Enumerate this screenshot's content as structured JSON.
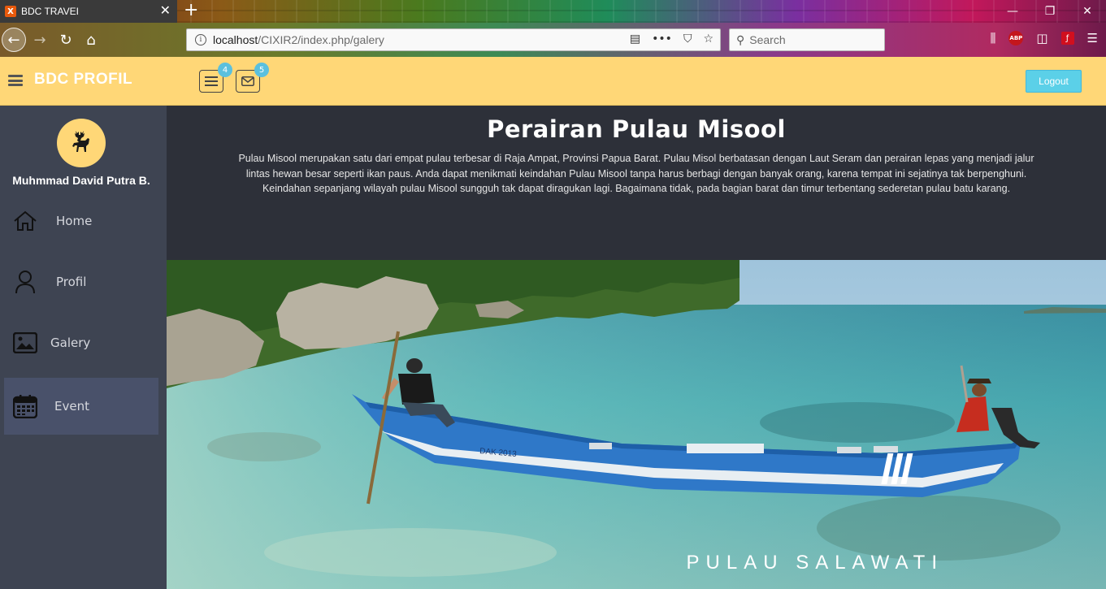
{
  "browser": {
    "tab_title": "BDC TRAVEI",
    "favicon_letter": "X",
    "url_host": "localhost",
    "url_path": "/CIXIR2/index.php/galery",
    "search_placeholder": "Search",
    "abp_label": "ABP"
  },
  "header": {
    "brand": "BDC PROFIL",
    "notifications_count": "4",
    "messages_count": "5",
    "logout_label": "Logout"
  },
  "sidebar": {
    "username": "Muhmmad David Putra B.",
    "items": [
      {
        "label": "Home",
        "icon": "home-icon"
      },
      {
        "label": "Profil",
        "icon": "user-icon"
      },
      {
        "label": "Galery",
        "icon": "image-icon"
      },
      {
        "label": "Event",
        "icon": "calendar-icon"
      }
    ],
    "active_item": "Event"
  },
  "main": {
    "title": "Perairan Pulau Misool",
    "description": "Pulau Misool merupakan satu dari empat pulau terbesar di Raja Ampat, Provinsi Papua Barat. Pulau Misol berbatasan dengan Laut Seram dan perairan lepas yang menjadi jalur lintas hewan besar seperti ikan paus. Anda dapat menikmati keindahan Pulau Misool tanpa harus berbagi dengan banyak orang, karena tempat ini sejatinya tak berpenghuni. Keindahan sepanjang wilayah pulau Misool sungguh tak dapat diragukan lagi. Bagaimana tidak, pada bagian barat dan timur terbentang sederetan pulau batu karang.",
    "photo_caption": "PULAU SALAWATI",
    "boat_label": "DAK 2013"
  },
  "colors": {
    "header_bg": "#ffd777",
    "sidebar_bg": "#3e4452",
    "main_bg": "#2d3039",
    "badge": "#5bc0de",
    "logout_bg": "#5bd0e8"
  }
}
